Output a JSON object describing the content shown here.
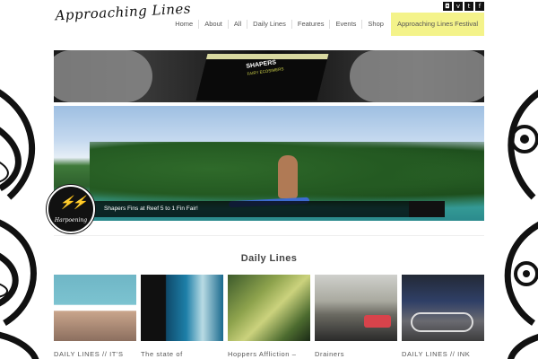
{
  "site": {
    "logo_text": "Approaching Lines"
  },
  "social_icons": [
    "instagram-icon",
    "vimeo-icon",
    "twitter-icon",
    "facebook-icon"
  ],
  "nav": {
    "items": [
      {
        "label": "Home"
      },
      {
        "label": "About"
      },
      {
        "label": "All"
      },
      {
        "label": "Daily Lines"
      },
      {
        "label": "Features"
      },
      {
        "label": "Events"
      },
      {
        "label": "Shop"
      }
    ],
    "festival_label": "Approaching Lines Festival",
    "festival_color": "#f4f38a"
  },
  "banner": {
    "brand": "SHAPERS",
    "brand_sub": "FAIRY ECOSIMERS"
  },
  "hero": {
    "caption": "Shapers Fins at Reef 5 to 1 Fin Fair!",
    "badge_text": "Harpoening"
  },
  "section": {
    "title": "Daily Lines"
  },
  "cards": [
    {
      "title": "DAILY LINES // IT'S"
    },
    {
      "title": "The state of"
    },
    {
      "title": "Hoppers Affliction –"
    },
    {
      "title": "Drainers"
    },
    {
      "title": "DAILY LINES // INK"
    }
  ]
}
